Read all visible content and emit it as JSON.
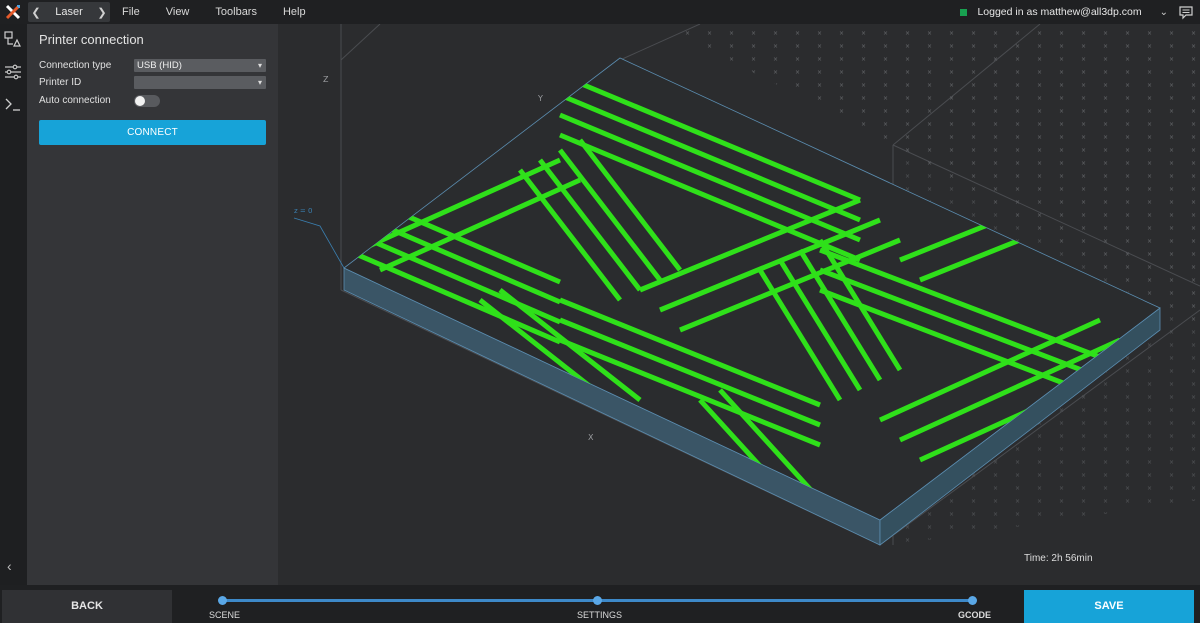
{
  "topbar": {
    "mode": "Laser",
    "menu": [
      "File",
      "View",
      "Toolbars",
      "Help"
    ],
    "user_label": "Logged in as matthew@all3dp.com",
    "status_color": "#18a050"
  },
  "panel": {
    "title": "Printer connection",
    "connection_type_label": "Connection type",
    "connection_type_value": "USB (HID)",
    "printer_id_label": "Printer ID",
    "printer_id_value": "",
    "auto_connection_label": "Auto connection",
    "auto_connection_on": false,
    "connect_label": "CONNECT"
  },
  "viewport": {
    "axis_z": "Z",
    "axis_y": "Y",
    "axis_x": "X",
    "z_plane": "z = 0",
    "toolpath_color": "#2fe01a",
    "time": "Time: 2h 56min"
  },
  "footer": {
    "back_label": "BACK",
    "save_label": "SAVE",
    "steps": [
      "SCENE",
      "SETTINGS",
      "GCODE"
    ],
    "accent": "#17a3d8"
  }
}
